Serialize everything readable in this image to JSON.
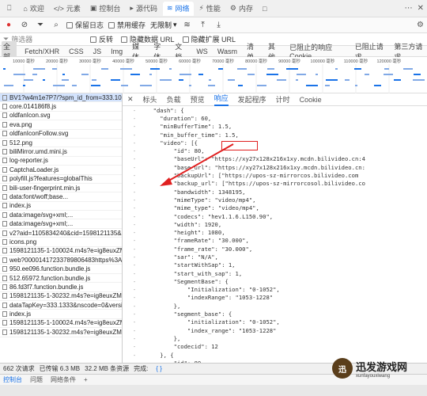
{
  "tabs": [
    {
      "icon": "⎕",
      "label": ""
    },
    {
      "icon": "⌂",
      "label": "欢迎"
    },
    {
      "icon": "</>",
      "label": "元素"
    },
    {
      "icon": "▣",
      "label": "控制台"
    },
    {
      "icon": "▸",
      "label": "源代码"
    },
    {
      "icon": "≋",
      "label": "网络"
    },
    {
      "icon": "⚡",
      "label": "性能"
    },
    {
      "icon": "⚙",
      "label": "内存"
    },
    {
      "icon": "□",
      "label": ""
    }
  ],
  "toolbar": {
    "preserve_log": "保留日志",
    "disable_cache": "禁用缓存",
    "throttling": "无限制"
  },
  "filter": {
    "placeholder": "筛选器",
    "invert": "反转",
    "hide_data_urls": "隐藏数据 URL",
    "hide_ext_urls": "隐藏扩展 URL"
  },
  "types": [
    "全部",
    "Fetch/XHR",
    "CSS",
    "JS",
    "Img",
    "媒体",
    "字体",
    "文档",
    "WS",
    "Wasm",
    "清单",
    "其他",
    "已阻止的响应 Cookie",
    "已阻止请求",
    "第三方请求"
  ],
  "timeline": {
    "ticks": [
      "10000 毫秒",
      "20000 毫秒",
      "30000 毫秒",
      "40000 毫秒",
      "50000 毫秒",
      "60000 毫秒",
      "70000 毫秒",
      "80000 毫秒",
      "90000 毫秒",
      "100000 毫秒",
      "110000 毫秒",
      "120000 毫秒"
    ]
  },
  "requests": [
    "BV1?w4m1e7P7/?spm_id_from=333.1007...",
    "core.014186f8.js",
    "oldfanIcon.svg",
    "eva.png",
    "oldfanIconFollow.svg",
    "512.png",
    "biliMirror.umd.mini.js",
    "log-reporter.js",
    "CaptchaLoader.js",
    "polyfill.js?features=globalThis",
    "bili-user-fingerprint.min.js",
    "data:font/woff;base...",
    "index.js",
    "data:image/svg+xml;...",
    "data:image/svg+xml;...",
    "v2?aid=1105834240&cid=1598121135&is...",
    "icons.png",
    "1598121135-1-100024.m4s?e=ig8euxZM2...",
    "web?00001417233789806483https%3A%2F...",
    "950.ee096.function.bundle.js",
    "512.65972.function.bundle.js",
    "86.fd3f7.function.bundle.js",
    "1598121135-1-30232.m4s?e=ig8euxZM2...",
    "dataTapKey=333.1333&nscode=0&versi...",
    "index.js",
    "1598121135-1-100024.m4s?e=ig8euxZM2...",
    "1598121135-1-30232.m4s?e=ig8euxZM2..."
  ],
  "detail_tabs": [
    "标头",
    "负载",
    "预览",
    "响应",
    "发起程序",
    "计时",
    "Cookie"
  ],
  "code_lines": [
    {
      "t": "  \"dash\": {"
    },
    {
      "t": "    \"duration\": 60,"
    },
    {
      "t": "    \"minBufferTime\": 1.5,"
    },
    {
      "t": "    \"min_buffer_time\": 1.5,"
    },
    {
      "t": "    \"video\": [{"
    },
    {
      "t": "        \"id\": 80,"
    },
    {
      "t": "        \"baseUrl\": \"https://xy27x128x216x1xy.mcdn.bilivideo.cn:4"
    },
    {
      "t": "        \"base_url\": \"https://xy27x128x216x1xy.mcdn.bilivideo.cn:"
    },
    {
      "t": "        \"backupUrl\": [\"https://upos-sz-mirrorcos.bilivideo.com"
    },
    {
      "t": "        \"backup_url\": [\"https://upos-sz-mirrorcosol.bilivideo.co"
    },
    {
      "t": "        \"bandwidth\": 1348195,"
    },
    {
      "t": "        \"mimeType\": \"video/mp4\","
    },
    {
      "t": "        \"mime_type\": \"video/mp4\","
    },
    {
      "t": "        \"codecs\": \"hev1.1.6.L150.90\","
    },
    {
      "t": "        \"width\": 1920,"
    },
    {
      "t": "        \"height\": 1080,"
    },
    {
      "t": "        \"frameRate\": \"30.000\","
    },
    {
      "t": "        \"frame_rate\": \"30.000\","
    },
    {
      "t": "        \"sar\": \"N/A\","
    },
    {
      "t": "        \"startWithSap\": 1,"
    },
    {
      "t": "        \"start_with_sap\": 1,"
    },
    {
      "t": "        \"SegmentBase\": {"
    },
    {
      "t": "            \"Initialization\": \"0-1052\","
    },
    {
      "t": "            \"indexRange\": \"1053-1228\""
    },
    {
      "t": "        },"
    },
    {
      "t": "        \"segment_base\": {"
    },
    {
      "t": "            \"initialization\": \"0-1052\","
    },
    {
      "t": "            \"index_range\": \"1053-1228\""
    },
    {
      "t": "        },"
    },
    {
      "t": "        \"codecid\": 12"
    },
    {
      "t": "    }, {"
    },
    {
      "t": "        \"id\": 80,"
    }
  ],
  "status": {
    "requests": "662 次请求",
    "transferred": "已传输 6.3 MB",
    "resources": "32.2 MB 条资源",
    "done": "完成:",
    "braces": "{ }"
  },
  "drawer": [
    "控制台",
    "问题",
    "网络条件"
  ],
  "watermark": {
    "logo": "迅",
    "text": "迅发游戏网",
    "sub": "xunfayouxiwang"
  },
  "colors": {
    "accent": "#1a73e8",
    "highlight": "#e02020",
    "selected_row": "#d3e3fd"
  }
}
